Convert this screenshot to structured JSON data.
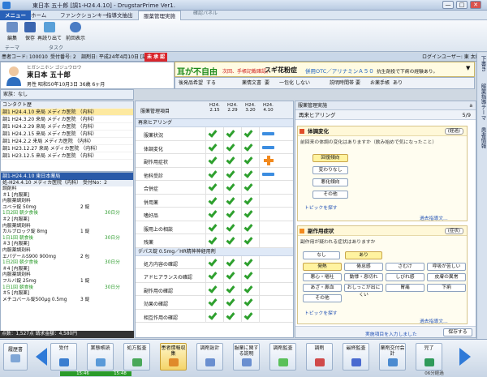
{
  "window": {
    "title": "東日本 五十郎 [調1-H24.4.10] - DrugstarPrime Ver1.",
    "min": "—",
    "max": "□",
    "close": "✕"
  },
  "menu_tabs": {
    "menu": "メニュー",
    "home": "ホーム",
    "function": "ファンクションキー",
    "guidance": "指導文抽出",
    "management": "服薬管理実施",
    "header_panel": "確認パネル"
  },
  "toolbar": {
    "edit": "編集",
    "save": "保存",
    "reread": "再読り出て",
    "prev_display": "前回表示",
    "group_theme": "テーマ",
    "group_task": "タスク"
  },
  "patient_bar": {
    "patient_code": "患者コード: 100010",
    "reception": "受付番号: 2",
    "dispense": "調剤日: 平成24年4月10日 [調1]",
    "status": "未 承 認",
    "login_user": "ログインユーザー: 東 太郎"
  },
  "patient": {
    "kana": "ヒガシニホン ゴジュウロウ",
    "name": "東日本 五十郎",
    "details": "男性  昭和50年10月3日  36歳 6ヶ月",
    "family": "家族：なし"
  },
  "alert": {
    "hearing": "耳が不自由",
    "sub": "次回、手帳記載確認。",
    "allergy": "スギ花粉症",
    "otc": "併用OTC／アリナミンＡ５０",
    "note": "抗生剤投で下痢の経験あり。"
  },
  "infobar": {
    "generic_label": "後発品希望",
    "generic_value": "する",
    "doc_label": "薬情文書",
    "doc_value": "要",
    "onedose_label": "一包化",
    "onedose_value": "しない",
    "time_label": "説明時間帯",
    "time_value": "要",
    "notebook_label": "お薬手帳",
    "notebook_value": "あり"
  },
  "vtabs": [
    "下書き",
    "服薬指導テーマ",
    "患者情報"
  ],
  "history": {
    "title": "コンタクト歴",
    "rows": [
      "調1 H24.4.10  来局  メディカ医院 （内科）",
      "調1 H24.3.20  来局  メディカ医院 （内科）",
      "調1 H24.2.29  来局  メディカ医院 （内科）",
      "調1 H24.2.15  来局  メディカ医院 （内科）",
      "調1 H24.2.2   来局  メディカ医院 （内科）",
      "調1 H23.12.27 来局  メディカ医院 （内科）",
      "調1 H23.12.5  来局  メディカ医院 （内科）"
    ]
  },
  "detail": {
    "header": "調1-H24.4.10 東日本薬局",
    "sub": "処-H24.4.10 メディカ医院（内科）  受付No：2",
    "rows": [
      {
        "t": "調剤料",
        "q": "",
        "d": ""
      },
      {
        "t": " ＃1 [内服薬]",
        "q": "",
        "d": ""
      },
      {
        "t": "  内服薬調剤料",
        "q": "",
        "d": ""
      },
      {
        "t": "  ユベラ錠 50mg",
        "q": "2 錠",
        "d": ""
      },
      {
        "t": "  1日2回 朝夕食後",
        "q": "",
        "d": "30日分",
        "g": true
      },
      {
        "t": " ＃2 [内服薬]",
        "q": "",
        "d": ""
      },
      {
        "t": "  内服薬調剤料",
        "q": "",
        "d": ""
      },
      {
        "t": "  カルブロック錠 8mg",
        "q": "1 錠",
        "d": ""
      },
      {
        "t": "  1日1回 朝食後",
        "q": "",
        "d": "30日分",
        "g": true
      },
      {
        "t": " ＃3 [内服薬]",
        "q": "",
        "d": ""
      },
      {
        "t": "  内服薬調剤料",
        "q": "",
        "d": ""
      },
      {
        "t": "  エパデールS900 900mg",
        "q": "2 包",
        "d": ""
      },
      {
        "t": "  1日2回 朝夕食後",
        "q": "",
        "d": "30日分",
        "g": true
      },
      {
        "t": " ＃4 [内服薬]",
        "q": "",
        "d": ""
      },
      {
        "t": "  内服薬調剤料",
        "q": "",
        "d": ""
      },
      {
        "t": "  フルバ錠 25mg",
        "q": "1 錠",
        "d": ""
      },
      {
        "t": "  1日1回 朝食後",
        "q": "",
        "d": "30日分",
        "g": true
      },
      {
        "t": " ＃5 [内服薬]",
        "q": "",
        "d": ""
      },
      {
        "t": "  メチコバール錠500μg 0.5mg",
        "q": "3 錠",
        "d": ""
      }
    ],
    "footer": "点数：1,527点  請求金額：4,580円"
  },
  "grid": {
    "title": "服薬管理項目",
    "dates": [
      "H24.\n2.15",
      "H24.\n2.29",
      "H24.\n3.20",
      "H24.\n4.10"
    ],
    "section1": "再来ヒアリング",
    "rows1": [
      {
        "label": "服薬状況",
        "marks": [
          "check",
          "check",
          "check",
          "dash"
        ]
      },
      {
        "label": "体調変化",
        "marks": [
          "check",
          "check",
          "check",
          "dash"
        ]
      },
      {
        "label": "副作用症状",
        "marks": [
          "check",
          "check",
          "check",
          "plus"
        ]
      },
      {
        "label": "他科受診",
        "marks": [
          "check",
          "check",
          "check",
          "dash"
        ]
      },
      {
        "label": "合併症",
        "marks": [
          "check",
          "check",
          "check",
          "none"
        ]
      },
      {
        "label": "併用薬",
        "marks": [
          "check",
          "check",
          "check",
          "none"
        ]
      },
      {
        "label": "嗜好品",
        "marks": [
          "check",
          "check",
          "check",
          "none"
        ]
      },
      {
        "label": "服用上の相談",
        "marks": [
          "check",
          "check",
          "check",
          "none"
        ]
      },
      {
        "label": "残薬",
        "marks": [
          "check",
          "check",
          "check",
          "none"
        ]
      }
    ],
    "section2": "デパス錠 0.5mg／HR精神神経用剤",
    "rows2": [
      {
        "label": "処方内容の確認",
        "marks": [
          "check",
          "check",
          "check",
          "none"
        ]
      },
      {
        "label": "アドヒアランスの確認",
        "marks": [
          "check",
          "check",
          "check",
          "none"
        ]
      },
      {
        "label": "副作用の確認",
        "marks": [
          "check",
          "check",
          "check",
          "none"
        ]
      },
      {
        "label": "効果の確認",
        "marks": [
          "check",
          "check",
          "check",
          "none"
        ]
      },
      {
        "label": "相互作用の確認",
        "marks": [
          "check",
          "check",
          "check",
          "none"
        ]
      }
    ]
  },
  "rpanel": {
    "title": "服薬管理実施",
    "close": "a",
    "section": "再来ヒアリング",
    "page": "5/9",
    "card1": {
      "title": "体調変化",
      "tag": "(経過)",
      "question": "前回来の体調の変化はありますか（飲み始めで気になったこと）",
      "options": [
        "回復傾向",
        "変わりなし",
        "悪化傾向",
        "その他"
      ],
      "selected": 0,
      "link1": "トピックを探す",
      "link2": "過去指導文…"
    },
    "card2": {
      "title": "副作用症状",
      "tag": "(症状)",
      "question": "副作用が疑われる症状はありますか",
      "yesno": [
        "なし",
        "あり"
      ],
      "yn_selected": 1,
      "symptoms": [
        "発熱",
        "倦怠感",
        "さむけ",
        "呼吸が苦しい",
        "悪心・嘔吐",
        "動悸・息切れ",
        "しびれ感",
        "皮膚の異常",
        "あざ・鼻血",
        "おしっこが出にくい",
        "胃痛",
        "下痢",
        "その他"
      ],
      "sym_selected": 0,
      "link1": "トピックを探す",
      "link2": "過去指導文…"
    },
    "footer_note": "実施項目を入力しました",
    "save": "保存する"
  },
  "process": {
    "prev": "履歴書",
    "steps": [
      "受付",
      "業態帳読",
      "処方監査",
      "患者情報収集",
      "調剤設計",
      "服薬に関する説明",
      "調剤監査",
      "調剤",
      "最終監査",
      "薬剤交付会計",
      "完了"
    ],
    "active": 3,
    "times": [
      "15:46",
      "15:48"
    ],
    "elapsed": "06分経過",
    "ok_label": "OK"
  }
}
